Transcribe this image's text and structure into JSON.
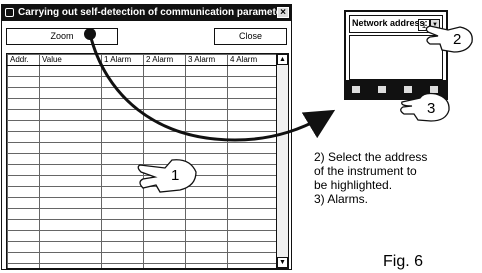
{
  "dialog": {
    "title": "Carrying out self-detection of communication paramete...",
    "close_glyph": "×",
    "zoom_label": "Zoom",
    "close_label": "Close",
    "columns": [
      "Addr.",
      "Value",
      "1 Alarm",
      "2 Alarm",
      "3 Alarm",
      "4 Alarm"
    ],
    "empty_row_count": 19
  },
  "instrument": {
    "label": "Network address:",
    "value": "1"
  },
  "callouts": [
    "1",
    "2",
    "3"
  ],
  "instructions": {
    "line1": "2) Select the address",
    "line2": "of the instrument to",
    "line3": "be highlighted.",
    "line4": "3) Alarms."
  },
  "figure_label": "Fig. 6"
}
